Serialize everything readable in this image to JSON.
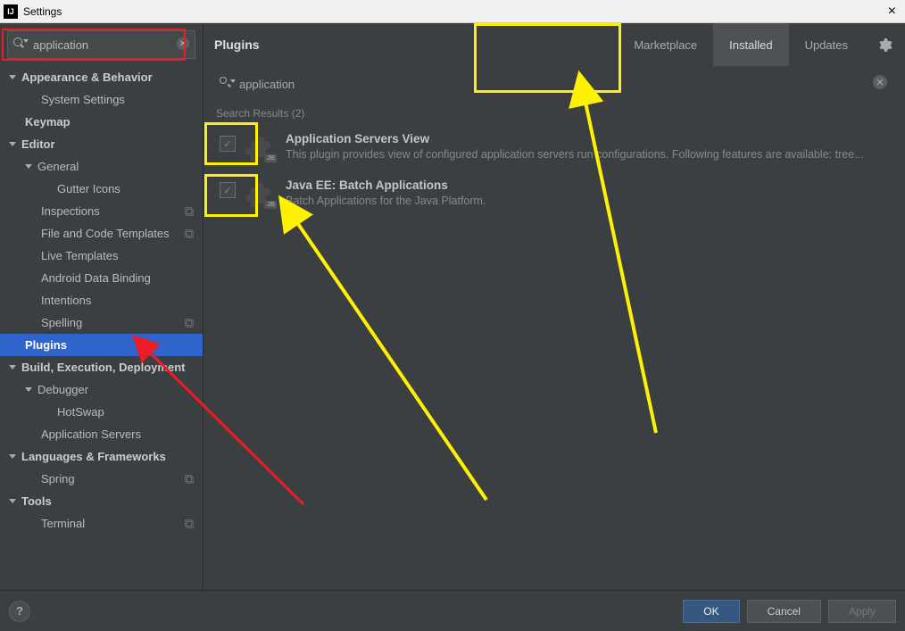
{
  "titlebar": {
    "app_icon": "IJ",
    "title": "Settings",
    "close": "×"
  },
  "sidebar": {
    "search_value": "application",
    "tree": [
      {
        "label": "Appearance & Behavior",
        "bold": true,
        "exp": true,
        "indent": 0
      },
      {
        "label": "System Settings",
        "indent": 2
      },
      {
        "label": "Keymap",
        "bold": true,
        "indent": 1
      },
      {
        "label": "Editor",
        "bold": true,
        "exp": true,
        "indent": 0
      },
      {
        "label": "General",
        "exp": true,
        "indent": 1
      },
      {
        "label": "Gutter Icons",
        "indent": 3
      },
      {
        "label": "Inspections",
        "indent": 2,
        "reset": true
      },
      {
        "label": "File and Code Templates",
        "indent": 2,
        "reset": true
      },
      {
        "label": "Live Templates",
        "indent": 2
      },
      {
        "label": "Android Data Binding",
        "indent": 2
      },
      {
        "label": "Intentions",
        "indent": 2
      },
      {
        "label": "Spelling",
        "indent": 2,
        "reset": true
      },
      {
        "label": "Plugins",
        "bold": true,
        "indent": 1,
        "selected": true
      },
      {
        "label": "Build, Execution, Deployment",
        "bold": true,
        "exp": true,
        "indent": 0
      },
      {
        "label": "Debugger",
        "exp": true,
        "indent": 1
      },
      {
        "label": "HotSwap",
        "indent": 3
      },
      {
        "label": "Application Servers",
        "indent": 2
      },
      {
        "label": "Languages & Frameworks",
        "bold": true,
        "exp": true,
        "indent": 0
      },
      {
        "label": "Spring",
        "indent": 2,
        "reset": true
      },
      {
        "label": "Tools",
        "bold": true,
        "exp": true,
        "indent": 0
      },
      {
        "label": "Terminal",
        "indent": 2,
        "reset": true
      }
    ]
  },
  "content": {
    "page_title": "Plugins",
    "tabs": [
      {
        "label": "Marketplace",
        "active": false
      },
      {
        "label": "Installed",
        "active": true
      },
      {
        "label": "Updates",
        "active": false
      }
    ],
    "search_value": "application",
    "results_label": "Search Results (2)",
    "plugins": [
      {
        "name": "Application Servers View",
        "desc": "This plugin provides view of configured application servers run configurations. Following features are available: tree...",
        "checked": true
      },
      {
        "name": "Java EE: Batch Applications",
        "desc": "Batch Applications for the Java Platform.",
        "checked": true
      }
    ]
  },
  "footer": {
    "help": "?",
    "ok": "OK",
    "cancel": "Cancel",
    "apply": "Apply"
  }
}
